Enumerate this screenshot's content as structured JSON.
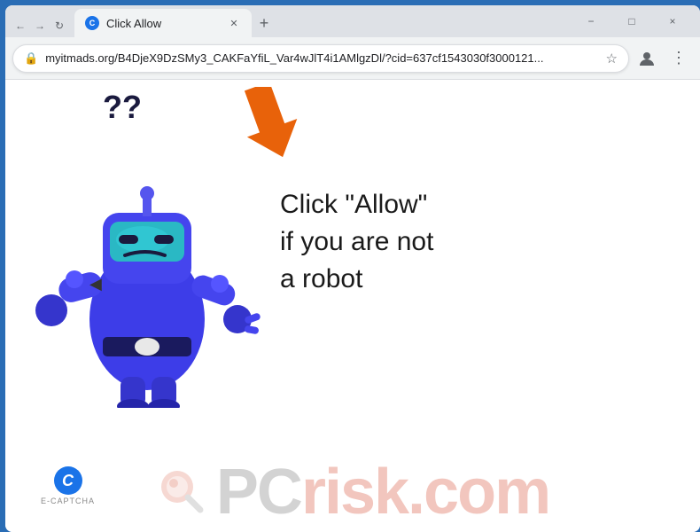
{
  "browser": {
    "tab": {
      "title": "Click Allow",
      "favicon_letter": "C"
    },
    "address": "myitmads.org/B4DjeX9DzSMy3_CAKFaYfiL_Var4wJlT4i1AMlgzDl/?cid=637cf1543030f3000121...",
    "new_tab_label": "+",
    "window_controls": {
      "minimize": "−",
      "maximize": "□",
      "close": "×"
    },
    "nav": {
      "back": "←",
      "forward": "→",
      "refresh": "↺"
    }
  },
  "page": {
    "question_marks": "??",
    "message_line1": "Click \"Allow\"",
    "message_line2": "if you are not",
    "message_line3": "a robot",
    "ecaptcha_letter": "C",
    "ecaptcha_label": "E-CAPTCHA",
    "pcrisk_prefix": "PC",
    "pcrisk_suffix": "risk.com"
  },
  "icons": {
    "lock": "🔒",
    "star": "☆",
    "profile": "👤",
    "menu": "⋮",
    "arrow_up_left": "↖"
  }
}
